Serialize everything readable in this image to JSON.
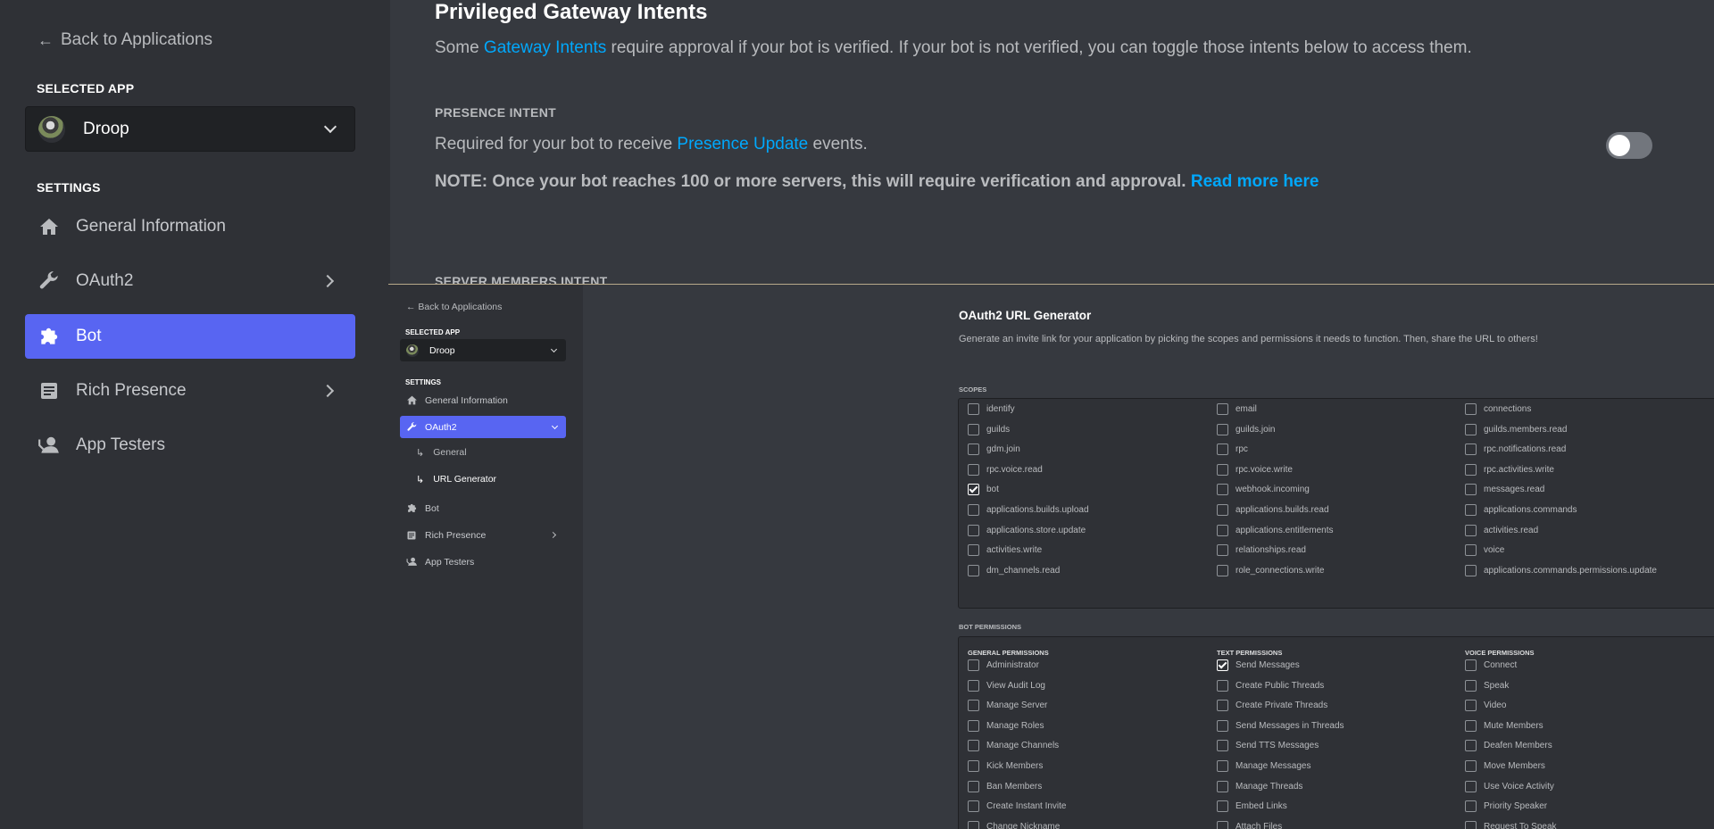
{
  "top": {
    "sidebar": {
      "back_label": "Back to Applications",
      "selected_app_heading": "SELECTED APP",
      "app_name": "Droop",
      "settings_heading": "SETTINGS",
      "items": [
        {
          "label": "General Information",
          "icon": "home-icon"
        },
        {
          "label": "OAuth2",
          "icon": "wrench-icon"
        },
        {
          "label": "Bot",
          "icon": "puzzle-icon"
        },
        {
          "label": "Rich Presence",
          "icon": "document-icon"
        },
        {
          "label": "App Testers",
          "icon": "user-icon"
        }
      ]
    },
    "main": {
      "title": "Privileged Gateway Intents",
      "intro_pre": "Some ",
      "intro_link": "Gateway Intents",
      "intro_post": " require approval if your bot is verified. If your bot is not verified, you can toggle those intents below to access them.",
      "presence_heading": "PRESENCE INTENT",
      "presence_pre": "Required for your bot to receive ",
      "presence_link": "Presence Update",
      "presence_post": " events.",
      "note_text": "NOTE: Once your bot reaches 100 or more servers, this will require verification and approval. ",
      "note_link": "Read more here",
      "server_members_heading": "SERVER MEMBERS INTENT"
    }
  },
  "overlay": {
    "sidebar": {
      "back_label": "Back to Applications",
      "selected_app_heading": "SELECTED APP",
      "app_name": "Droop",
      "settings_heading": "SETTINGS",
      "items": [
        {
          "label": "General Information"
        },
        {
          "label": "OAuth2"
        },
        {
          "label": "General"
        },
        {
          "label": "URL Generator"
        },
        {
          "label": "Bot"
        },
        {
          "label": "Rich Presence"
        },
        {
          "label": "App Testers"
        }
      ]
    },
    "main": {
      "title": "OAuth2 URL Generator",
      "description": "Generate an invite link for your application by picking the scopes and permissions it needs to function. Then, share the URL to others!",
      "scopes_heading": "SCOPES",
      "scopes": [
        {
          "label": "identify",
          "checked": false
        },
        {
          "label": "email",
          "checked": false
        },
        {
          "label": "connections",
          "checked": false
        },
        {
          "label": "guilds",
          "checked": false
        },
        {
          "label": "guilds.join",
          "checked": false
        },
        {
          "label": "guilds.members.read",
          "checked": false
        },
        {
          "label": "gdm.join",
          "checked": false
        },
        {
          "label": "rpc",
          "checked": false
        },
        {
          "label": "rpc.notifications.read",
          "checked": false
        },
        {
          "label": "rpc.voice.read",
          "checked": false
        },
        {
          "label": "rpc.voice.write",
          "checked": false
        },
        {
          "label": "rpc.activities.write",
          "checked": false
        },
        {
          "label": "bot",
          "checked": true
        },
        {
          "label": "webhook.incoming",
          "checked": false
        },
        {
          "label": "messages.read",
          "checked": false
        },
        {
          "label": "applications.builds.upload",
          "checked": false
        },
        {
          "label": "applications.builds.read",
          "checked": false
        },
        {
          "label": "applications.commands",
          "checked": false
        },
        {
          "label": "applications.store.update",
          "checked": false
        },
        {
          "label": "applications.entitlements",
          "checked": false
        },
        {
          "label": "activities.read",
          "checked": false
        },
        {
          "label": "activities.write",
          "checked": false
        },
        {
          "label": "relationships.read",
          "checked": false
        },
        {
          "label": "voice",
          "checked": false
        },
        {
          "label": "dm_channels.read",
          "checked": false
        },
        {
          "label": "role_connections.write",
          "checked": false
        },
        {
          "label": "applications.commands.permissions.update",
          "checked": false
        }
      ],
      "bot_permissions_heading": "BOT PERMISSIONS",
      "permission_groups": [
        {
          "heading": "GENERAL PERMISSIONS",
          "items": [
            {
              "label": "Administrator",
              "checked": false
            },
            {
              "label": "View Audit Log",
              "checked": false
            },
            {
              "label": "Manage Server",
              "checked": false
            },
            {
              "label": "Manage Roles",
              "checked": false
            },
            {
              "label": "Manage Channels",
              "checked": false
            },
            {
              "label": "Kick Members",
              "checked": false
            },
            {
              "label": "Ban Members",
              "checked": false
            },
            {
              "label": "Create Instant Invite",
              "checked": false
            },
            {
              "label": "Change Nickname",
              "checked": false
            }
          ]
        },
        {
          "heading": "TEXT PERMISSIONS",
          "items": [
            {
              "label": "Send Messages",
              "checked": true
            },
            {
              "label": "Create Public Threads",
              "checked": false
            },
            {
              "label": "Create Private Threads",
              "checked": false
            },
            {
              "label": "Send Messages in Threads",
              "checked": false
            },
            {
              "label": "Send TTS Messages",
              "checked": false
            },
            {
              "label": "Manage Messages",
              "checked": false
            },
            {
              "label": "Manage Threads",
              "checked": false
            },
            {
              "label": "Embed Links",
              "checked": false
            },
            {
              "label": "Attach Files",
              "checked": false
            }
          ]
        },
        {
          "heading": "VOICE PERMISSIONS",
          "items": [
            {
              "label": "Connect",
              "checked": false
            },
            {
              "label": "Speak",
              "checked": false
            },
            {
              "label": "Video",
              "checked": false
            },
            {
              "label": "Mute Members",
              "checked": false
            },
            {
              "label": "Deafen Members",
              "checked": false
            },
            {
              "label": "Move Members",
              "checked": false
            },
            {
              "label": "Use Voice Activity",
              "checked": false
            },
            {
              "label": "Priority Speaker",
              "checked": false
            },
            {
              "label": "Request To Speak",
              "checked": false
            }
          ]
        }
      ]
    }
  }
}
